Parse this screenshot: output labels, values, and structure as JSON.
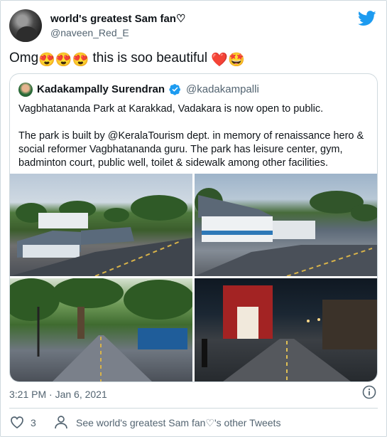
{
  "author": {
    "name": "world's greatest Sam fan♡",
    "handle": "@naveen_Red_E"
  },
  "tweet": {
    "text_prefix": "Omg",
    "emojis_1": "😍😍😍",
    "text_middle": " this is soo beautiful ",
    "emojis_2": "❤️🤩"
  },
  "quoted_tweet": {
    "name": "Kadakampally Surendran",
    "handle": "@kadakampalli",
    "line1": "Vagbhatananda Park at Karakkad, Vadakara is now open to public.",
    "line2": "The park is built by @KeralaTourism dept. in memory of renaissance hero & social reformer Vagbhatananda guru. The park has leisure center, gym, badminton court, public well, toilet & sidewalk among other facilities.",
    "photos": [
      "park-aerial-view",
      "park-building-walkway",
      "tree-lined-walkway",
      "walkway-at-night"
    ]
  },
  "timestamp": "3:21 PM · Jan 6, 2021",
  "footer": {
    "like_count": "3",
    "see_more": "See world's greatest Sam fan♡'s other Tweets"
  },
  "colors": {
    "twitter_blue": "#1d9bf0",
    "secondary_text": "#536471",
    "border": "#cfd9de"
  }
}
